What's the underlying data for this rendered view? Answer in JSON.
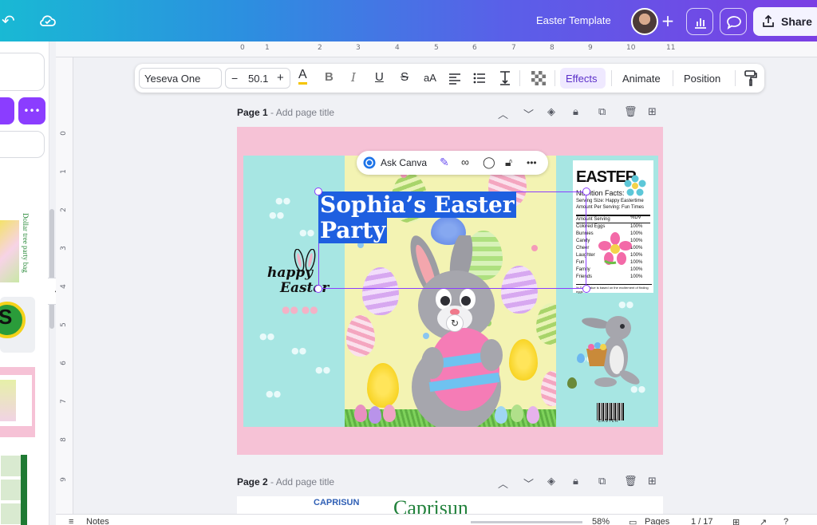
{
  "topbar": {
    "doc_title": "Easter Template",
    "share_label": "Share",
    "icons": [
      "undo-icon",
      "cloud-check-icon",
      "plus-icon",
      "analytics-icon",
      "comment-icon",
      "share-upload-icon"
    ]
  },
  "left_panel": {
    "more_label": "•••",
    "thumb_text": "Dollar tree party bag",
    "collapse_label": "‹"
  },
  "ruler": {
    "top": [
      "0",
      "0.1",
      "1",
      "2",
      "3",
      "4",
      "5",
      "6",
      "7",
      "8",
      "9",
      "10",
      "11"
    ],
    "left": [
      "0",
      "1",
      "2",
      "3",
      "4",
      "5",
      "6",
      "7",
      "8",
      "9"
    ]
  },
  "toolbar": {
    "font_name": "Yeseva One",
    "font_size": "50.1",
    "minus": "−",
    "plus": "+",
    "effects_label": "Effects",
    "animate_label": "Animate",
    "position_label": "Position"
  },
  "pages": [
    {
      "label": "Page 1",
      "sub": " - Add page title"
    },
    {
      "label": "Page 2",
      "sub": " - Add page title"
    }
  ],
  "design": {
    "title_line1": "Sophia’s Easter",
    "title_line2": "Party",
    "ask_canva": "Ask Canva",
    "ask_more": "•••",
    "happy": "happy",
    "easter_script": "Easter",
    "nutrition": {
      "heading": "EASTER",
      "facts": "Nutrition Facts:",
      "serving_size": "Serving Size: Happy Eastertime",
      "servings": "Amount Per Serving: Fun Times",
      "amount_header": "Amount Serving",
      "dv_header": "%DV",
      "rows": [
        {
          "name": "Colored Eggs",
          "dv": "100%"
        },
        {
          "name": "Bunnies",
          "dv": "100%"
        },
        {
          "name": "Candy",
          "dv": "100%"
        },
        {
          "name": "Cheer",
          "dv": "100%"
        },
        {
          "name": "Laughter",
          "dv": "100%"
        },
        {
          "name": "Fun",
          "dv": "100%"
        },
        {
          "name": "Family",
          "dv": "100%"
        },
        {
          "name": "Friends",
          "dv": "100%"
        }
      ],
      "footnote": "% Daily Value is based on the excitement of finding eggs"
    },
    "barcode_label": "EASTER"
  },
  "page2": {
    "logo": "CAPRISUN",
    "title": "Caprisun"
  },
  "bottombar": {
    "notes": "Notes",
    "zoom": "58%",
    "pages": "Pages",
    "page_count": "1 / 17"
  }
}
